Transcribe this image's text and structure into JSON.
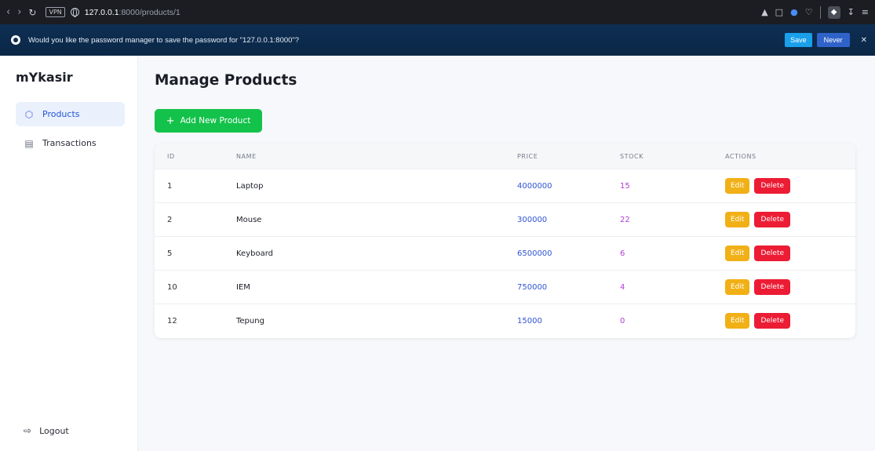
{
  "browser": {
    "vpn": "VPN",
    "url_host": "127.0.0.1",
    "url_rest": ":8000/products/1"
  },
  "password_prompt": {
    "message": "Would you like the password manager to save the password for \"127.0.0.1:8000\"?",
    "save_label": "Save",
    "never_label": "Never"
  },
  "sidebar": {
    "brand": "mYkasir",
    "items": [
      {
        "label": "Products",
        "icon": "box-icon"
      },
      {
        "label": "Transactions",
        "icon": "receipt-icon"
      }
    ],
    "logout": "Logout"
  },
  "main": {
    "title": "Manage Products",
    "add_button": "Add New Product",
    "columns": [
      "ID",
      "NAME",
      "PRICE",
      "STOCK",
      "ACTIONS"
    ],
    "rows": [
      {
        "id": "1",
        "name": "Laptop",
        "price": "4000000",
        "stock": "15"
      },
      {
        "id": "2",
        "name": "Mouse",
        "price": "300000",
        "stock": "22"
      },
      {
        "id": "5",
        "name": "Keyboard",
        "price": "6500000",
        "stock": "6"
      },
      {
        "id": "10",
        "name": "IEM",
        "price": "750000",
        "stock": "4"
      },
      {
        "id": "12",
        "name": "Tepung",
        "price": "15000",
        "stock": "0"
      }
    ],
    "edit_label": "Edit",
    "delete_label": "Delete"
  },
  "colors": {
    "accent_green": "#13c24a",
    "price_blue": "#2f55d4",
    "stock_purple": "#b23ed8",
    "edit_yellow": "#f1b016",
    "delete_red": "#ec1c34"
  }
}
